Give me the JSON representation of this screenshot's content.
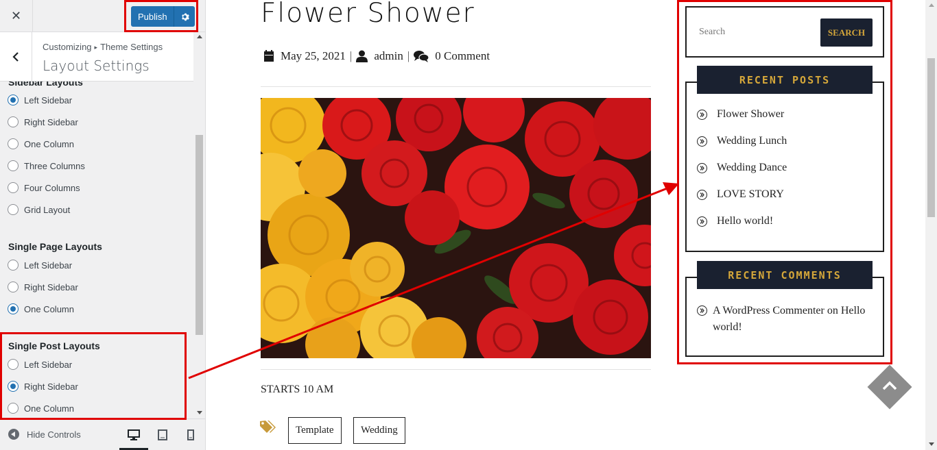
{
  "panel": {
    "close_icon": "close-icon",
    "publish_label": "Publish",
    "breadcrumb_root": "Customizing",
    "breadcrumb_parent": "Theme Settings",
    "section_title": "Layout Settings",
    "groups": {
      "sidebar": {
        "title": "Sidebar Layouts",
        "options": [
          "Left Sidebar",
          "Right Sidebar",
          "One Column",
          "Three Columns",
          "Four Columns",
          "Grid Layout"
        ],
        "selected": "Left Sidebar"
      },
      "single_page": {
        "title": "Single Page Layouts",
        "options": [
          "Left Sidebar",
          "Right Sidebar",
          "One Column"
        ],
        "selected": "One Column"
      },
      "single_post": {
        "title": "Single Post Layouts",
        "options": [
          "Left Sidebar",
          "Right Sidebar",
          "One Column"
        ],
        "selected": "Right Sidebar"
      }
    },
    "footer": {
      "hide_controls_label": "Hide Controls",
      "active_device": "desktop"
    }
  },
  "preview": {
    "post_title": "Flower Shower",
    "meta": {
      "date": "May 25, 2021",
      "author": "admin",
      "comments": "0 Comment",
      "separator": "|"
    },
    "excerpt": "STARTS 10 AM",
    "tags": [
      "Template",
      "Wedding"
    ],
    "sidebar": {
      "search_placeholder": "Search",
      "search_button": "SEARCH",
      "recent_posts_title": "RECENT POSTS",
      "recent_posts": [
        "Flower Shower",
        "Wedding Lunch",
        "Wedding Dance",
        "LOVE STORY",
        "Hello world!"
      ],
      "recent_comments_title": "RECENT COMMENTS",
      "comment_author": "A WordPress Commenter",
      "comment_on": "on",
      "comment_post": "Hello world!"
    }
  },
  "colors": {
    "wp_blue": "#2271b1",
    "widget_dark": "#1a2130",
    "widget_gold": "#d5a73a",
    "annotation_red": "#e00000"
  }
}
